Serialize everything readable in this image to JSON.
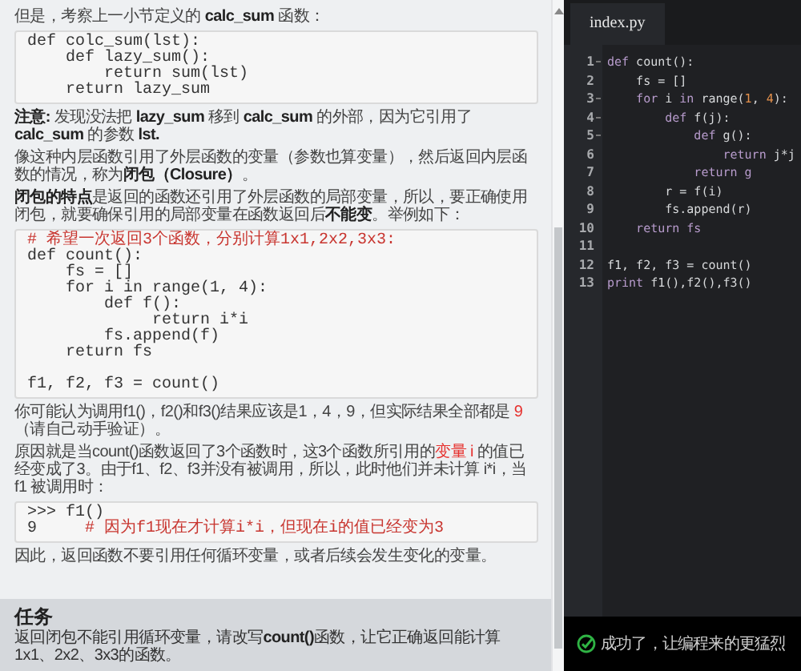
{
  "lesson": {
    "blocks": [
      {
        "kind": "paragraph",
        "parts": [
          {
            "text": "但是，考察上一小节定义的 **calc_sum** 函数：",
            "red": false
          }
        ]
      },
      {
        "kind": "code",
        "lines": [
          {
            "code": "def colc_sum(lst):\n    def lazy_sum():\n        return sum(lst)\n    return lazy_sum"
          }
        ]
      },
      {
        "kind": "paragraph",
        "parts": [
          {
            "text": "**注意:** 发现没法把 **lazy_sum** 移到 **calc_sum** 的外部，因为它引用了 **calc_sum** 的参数 **lst.**",
            "red": false
          }
        ]
      },
      {
        "kind": "paragraph",
        "parts": [
          {
            "text": "像这种内层函数引用了外层函数的变量（参数也算变量），然后返回内层函数的情况，称为**闭包（Closure）**。",
            "red": false
          }
        ]
      },
      {
        "kind": "paragraph",
        "parts": [
          {
            "text": "**闭包的特点**是返回的函数还引用了外层函数的局部变量，所以，要正确使用闭包，就要确保引用的局部变量在函数返回后**不能变**。举例如下：",
            "red": false
          }
        ]
      },
      {
        "kind": "code",
        "lines": [
          {
            "comment": "# 希望一次返回3个函数，分别计算1x1,2x2,3x3:"
          },
          {
            "code": "def count():\n    fs = []\n    for i in range(1, 4):\n        def f():\n             return i*i\n        fs.append(f)\n    return fs\n\nf1, f2, f3 = count()"
          }
        ]
      },
      {
        "kind": "paragraph",
        "parts": [
          {
            "text": "你可能认为调用f1()，f2()和f3()结果应该是1，4，9，但实际结果全部都是 ",
            "red": false
          },
          {
            "text": "9",
            "red": true
          },
          {
            "text": "（请自己动手验证）。",
            "red": false
          }
        ]
      },
      {
        "kind": "paragraph",
        "parts": [
          {
            "text": "原因就是当count()函数返回了3个函数时，这3个函数所引用的",
            "red": false
          },
          {
            "text": "变量 i",
            "red": true
          },
          {
            "text": " 的值已经变成了3。由于f1、f2、f3并没有被调用，所以，此时他们并未计算 i*i，当 f1 被调用时：",
            "red": false
          }
        ]
      },
      {
        "kind": "code",
        "lines": [
          {
            "code": ">>> f1()"
          },
          {
            "code": "9     ",
            "comment": "# 因为f1现在才计算i*i，但现在i的值已经变为3"
          }
        ]
      },
      {
        "kind": "paragraph",
        "parts": [
          {
            "text": "因此，返回函数不要引用任何循环变量，或者后续会发生变化的变量。",
            "red": false
          }
        ]
      }
    ]
  },
  "task": {
    "title": "任务",
    "text": "返回闭包不能引用循环变量，请改写**count()**函数，让它正确返回能计算1x1、2x2、3x3的函数。"
  },
  "editor": {
    "tab": {
      "label": "index.py",
      "selected": true
    },
    "lines": [
      {
        "number": "1",
        "foldable": true,
        "tokens": [
          {
            "t": "def",
            "kind": "keyword"
          },
          {
            "t": " count():",
            "kind": "plain"
          }
        ]
      },
      {
        "number": "2",
        "foldable": false,
        "tokens": [
          {
            "t": "    fs = []",
            "kind": "plain"
          }
        ]
      },
      {
        "number": "3",
        "foldable": true,
        "tokens": [
          {
            "t": "    for",
            "kind": "keyword"
          },
          {
            "t": " i ",
            "kind": "plain"
          },
          {
            "t": "in",
            "kind": "keyword"
          },
          {
            "t": " range(",
            "kind": "plain"
          },
          {
            "t": "1",
            "kind": "number"
          },
          {
            "t": ", ",
            "kind": "plain"
          },
          {
            "t": "4",
            "kind": "number"
          },
          {
            "t": "):",
            "kind": "plain"
          }
        ]
      },
      {
        "number": "4",
        "foldable": true,
        "tokens": [
          {
            "t": "        def",
            "kind": "keyword"
          },
          {
            "t": " f(j):",
            "kind": "plain"
          }
        ]
      },
      {
        "number": "5",
        "foldable": true,
        "tokens": [
          {
            "t": "            def",
            "kind": "keyword"
          },
          {
            "t": " g():",
            "kind": "plain"
          }
        ]
      },
      {
        "number": "6",
        "foldable": false,
        "tokens": [
          {
            "t": "                return",
            "kind": "keyword"
          },
          {
            "t": " j*j",
            "kind": "plain"
          }
        ]
      },
      {
        "number": "7",
        "foldable": false,
        "tokens": [
          {
            "t": "            return g",
            "kind": "keyword"
          }
        ]
      },
      {
        "number": "8",
        "foldable": false,
        "tokens": [
          {
            "t": "        r = f(i)",
            "kind": "plain"
          }
        ]
      },
      {
        "number": "9",
        "foldable": false,
        "tokens": [
          {
            "t": "        fs.append(r)",
            "kind": "plain"
          }
        ]
      },
      {
        "number": "10",
        "foldable": false,
        "tokens": [
          {
            "t": "    return fs",
            "kind": "keyword"
          }
        ]
      },
      {
        "number": "11",
        "foldable": false
      },
      {
        "number": "12",
        "foldable": false,
        "tokens": [
          {
            "t": "f1, f2, f3 = count()",
            "kind": "plain"
          }
        ]
      },
      {
        "number": "13",
        "foldable": false,
        "tokens": [
          {
            "t": "print",
            "kind": "keyword"
          },
          {
            "t": " f1(),f2(),f3()",
            "kind": "plain"
          }
        ]
      }
    ]
  },
  "result": {
    "success": true,
    "message": "成功了，让编程来的更猛烈"
  }
}
